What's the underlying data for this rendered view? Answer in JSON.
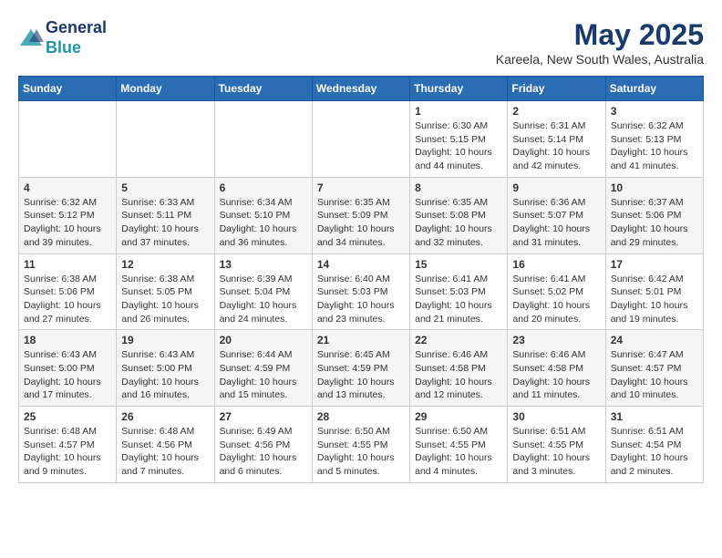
{
  "header": {
    "logo_line1": "General",
    "logo_line2": "Blue",
    "title": "May 2025",
    "location": "Kareela, New South Wales, Australia"
  },
  "days_of_week": [
    "Sunday",
    "Monday",
    "Tuesday",
    "Wednesday",
    "Thursday",
    "Friday",
    "Saturday"
  ],
  "weeks": [
    [
      {
        "day": "",
        "info": ""
      },
      {
        "day": "",
        "info": ""
      },
      {
        "day": "",
        "info": ""
      },
      {
        "day": "",
        "info": ""
      },
      {
        "day": "1",
        "info": "Sunrise: 6:30 AM\nSunset: 5:15 PM\nDaylight: 10 hours\nand 44 minutes."
      },
      {
        "day": "2",
        "info": "Sunrise: 6:31 AM\nSunset: 5:14 PM\nDaylight: 10 hours\nand 42 minutes."
      },
      {
        "day": "3",
        "info": "Sunrise: 6:32 AM\nSunset: 5:13 PM\nDaylight: 10 hours\nand 41 minutes."
      }
    ],
    [
      {
        "day": "4",
        "info": "Sunrise: 6:32 AM\nSunset: 5:12 PM\nDaylight: 10 hours\nand 39 minutes."
      },
      {
        "day": "5",
        "info": "Sunrise: 6:33 AM\nSunset: 5:11 PM\nDaylight: 10 hours\nand 37 minutes."
      },
      {
        "day": "6",
        "info": "Sunrise: 6:34 AM\nSunset: 5:10 PM\nDaylight: 10 hours\nand 36 minutes."
      },
      {
        "day": "7",
        "info": "Sunrise: 6:35 AM\nSunset: 5:09 PM\nDaylight: 10 hours\nand 34 minutes."
      },
      {
        "day": "8",
        "info": "Sunrise: 6:35 AM\nSunset: 5:08 PM\nDaylight: 10 hours\nand 32 minutes."
      },
      {
        "day": "9",
        "info": "Sunrise: 6:36 AM\nSunset: 5:07 PM\nDaylight: 10 hours\nand 31 minutes."
      },
      {
        "day": "10",
        "info": "Sunrise: 6:37 AM\nSunset: 5:06 PM\nDaylight: 10 hours\nand 29 minutes."
      }
    ],
    [
      {
        "day": "11",
        "info": "Sunrise: 6:38 AM\nSunset: 5:06 PM\nDaylight: 10 hours\nand 27 minutes."
      },
      {
        "day": "12",
        "info": "Sunrise: 6:38 AM\nSunset: 5:05 PM\nDaylight: 10 hours\nand 26 minutes."
      },
      {
        "day": "13",
        "info": "Sunrise: 6:39 AM\nSunset: 5:04 PM\nDaylight: 10 hours\nand 24 minutes."
      },
      {
        "day": "14",
        "info": "Sunrise: 6:40 AM\nSunset: 5:03 PM\nDaylight: 10 hours\nand 23 minutes."
      },
      {
        "day": "15",
        "info": "Sunrise: 6:41 AM\nSunset: 5:03 PM\nDaylight: 10 hours\nand 21 minutes."
      },
      {
        "day": "16",
        "info": "Sunrise: 6:41 AM\nSunset: 5:02 PM\nDaylight: 10 hours\nand 20 minutes."
      },
      {
        "day": "17",
        "info": "Sunrise: 6:42 AM\nSunset: 5:01 PM\nDaylight: 10 hours\nand 19 minutes."
      }
    ],
    [
      {
        "day": "18",
        "info": "Sunrise: 6:43 AM\nSunset: 5:00 PM\nDaylight: 10 hours\nand 17 minutes."
      },
      {
        "day": "19",
        "info": "Sunrise: 6:43 AM\nSunset: 5:00 PM\nDaylight: 10 hours\nand 16 minutes."
      },
      {
        "day": "20",
        "info": "Sunrise: 6:44 AM\nSunset: 4:59 PM\nDaylight: 10 hours\nand 15 minutes."
      },
      {
        "day": "21",
        "info": "Sunrise: 6:45 AM\nSunset: 4:59 PM\nDaylight: 10 hours\nand 13 minutes."
      },
      {
        "day": "22",
        "info": "Sunrise: 6:46 AM\nSunset: 4:58 PM\nDaylight: 10 hours\nand 12 minutes."
      },
      {
        "day": "23",
        "info": "Sunrise: 6:46 AM\nSunset: 4:58 PM\nDaylight: 10 hours\nand 11 minutes."
      },
      {
        "day": "24",
        "info": "Sunrise: 6:47 AM\nSunset: 4:57 PM\nDaylight: 10 hours\nand 10 minutes."
      }
    ],
    [
      {
        "day": "25",
        "info": "Sunrise: 6:48 AM\nSunset: 4:57 PM\nDaylight: 10 hours\nand 9 minutes."
      },
      {
        "day": "26",
        "info": "Sunrise: 6:48 AM\nSunset: 4:56 PM\nDaylight: 10 hours\nand 7 minutes."
      },
      {
        "day": "27",
        "info": "Sunrise: 6:49 AM\nSunset: 4:56 PM\nDaylight: 10 hours\nand 6 minutes."
      },
      {
        "day": "28",
        "info": "Sunrise: 6:50 AM\nSunset: 4:55 PM\nDaylight: 10 hours\nand 5 minutes."
      },
      {
        "day": "29",
        "info": "Sunrise: 6:50 AM\nSunset: 4:55 PM\nDaylight: 10 hours\nand 4 minutes."
      },
      {
        "day": "30",
        "info": "Sunrise: 6:51 AM\nSunset: 4:55 PM\nDaylight: 10 hours\nand 3 minutes."
      },
      {
        "day": "31",
        "info": "Sunrise: 6:51 AM\nSunset: 4:54 PM\nDaylight: 10 hours\nand 2 minutes."
      }
    ]
  ]
}
